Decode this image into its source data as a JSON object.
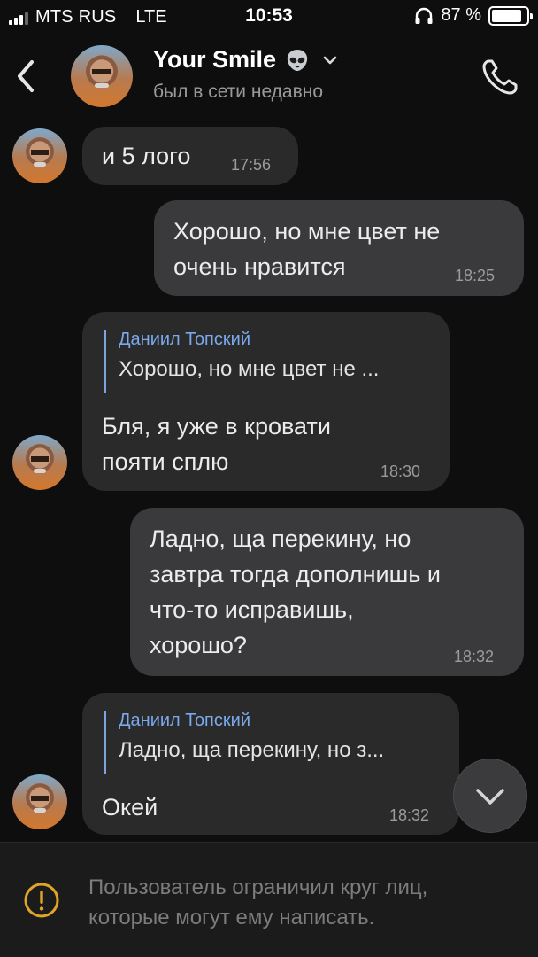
{
  "status_bar": {
    "carrier": "MTS RUS",
    "network": "LTE",
    "time": "10:53",
    "battery": "87 %",
    "battery_level": 0.87
  },
  "header": {
    "title": "Your Smile",
    "title_icon": "alien-emoji",
    "status": "был в сети недавно"
  },
  "messages": [
    {
      "direction": "in",
      "text": "и 5 лого",
      "time": "17:56"
    },
    {
      "direction": "out",
      "lines": [
        "Хорошо, но мне цвет не",
        "очень нравится"
      ],
      "time": "18:25"
    },
    {
      "direction": "in",
      "reply": {
        "author": "Даниил Топский",
        "text": "Хорошо, но мне цвет не ..."
      },
      "lines": [
        "Бля, я уже в кровати",
        "пояти сплю"
      ],
      "time": "18:30"
    },
    {
      "direction": "out",
      "lines": [
        "Ладно, ща перекину, но",
        "завтра тогда дополнишь и",
        "что-то исправишь,",
        "хорошо?"
      ],
      "time": "18:32"
    },
    {
      "direction": "in",
      "reply": {
        "author": "Даниил Топский",
        "text": "Ладно, ща перекину, но з..."
      },
      "text": "Окей",
      "time": "18:32"
    }
  ],
  "footer": {
    "notice_lines": [
      "Пользователь ограничил круг лиц,",
      "которые могут ему написать."
    ]
  },
  "colors": {
    "background": "#0e0e0e",
    "incoming_bubble": "#2a2a2a",
    "outgoing_bubble": "#3a3a3c",
    "reply_accent": "#7aa9ec",
    "warning": "#e0a526"
  }
}
